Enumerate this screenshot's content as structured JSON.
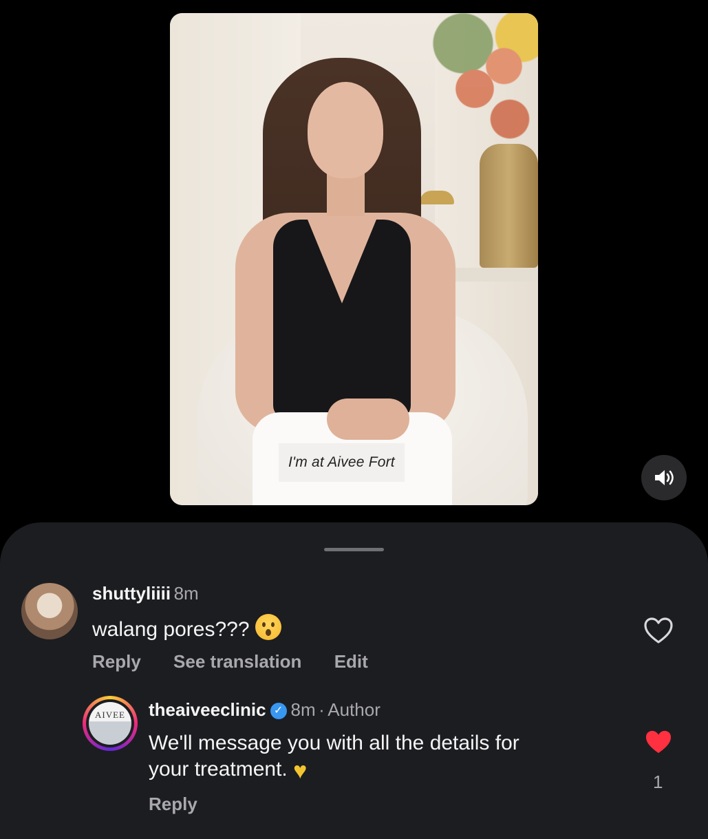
{
  "video": {
    "caption": "I'm at Aivee Fort"
  },
  "sound_button": {
    "icon": "speaker-on-icon"
  },
  "comments": [
    {
      "username": "shuttyliiii",
      "time": "8m",
      "text": "walang pores???",
      "emoji": "astonished-face-emoji",
      "actions": {
        "reply": "Reply",
        "translate": "See translation",
        "edit": "Edit"
      },
      "liked": false
    },
    {
      "username": "theaiveeclinic",
      "verified": true,
      "time": "8m",
      "separator": "·",
      "author_badge": "Author",
      "avatar_text": "AIVEE",
      "text_line1": "We'll message you with all the details for",
      "text_line2": "your treatment.",
      "emoji": "yellow-heart-emoji",
      "actions": {
        "reply": "Reply"
      },
      "liked": true,
      "like_count": "1"
    }
  ],
  "colors": {
    "like_red": "#ff3040",
    "sheet_bg": "#1c1d21",
    "muted_text": "#a8a8ad"
  }
}
